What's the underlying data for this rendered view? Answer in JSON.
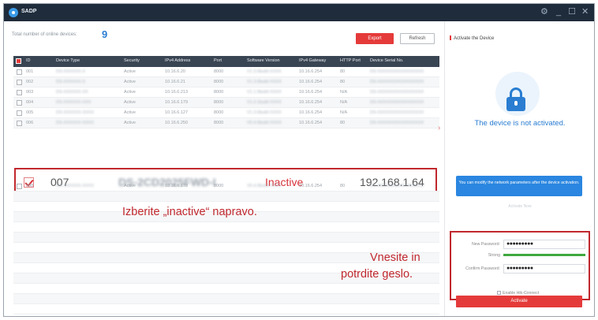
{
  "app": {
    "title": "SADP"
  },
  "header": {
    "total_label": "Total number of online devices:",
    "total_count": "9",
    "export_label": "Export",
    "refresh_label": "Refresh"
  },
  "table": {
    "columns": [
      "ID",
      "Device Type",
      "Security",
      "IPv4 Address",
      "Port",
      "Software Version",
      "IPv4 Gateway",
      "HTTP Port",
      "Device Serial No."
    ],
    "rows": [
      {
        "id": "001",
        "type": "DS-XXXXXX-X",
        "security": "Active",
        "ip": "10.16.6.20",
        "port": "8000",
        "software": "V1.3.0build XXXX",
        "gateway": "10.16.6.254",
        "http": "80",
        "serial": "DS-XXXXXXXXXXXXXXXX"
      },
      {
        "id": "002",
        "type": "DS-XXXXXX-X",
        "security": "Active",
        "ip": "10.16.6.21",
        "port": "8000",
        "software": "V1.3.0build XXXX",
        "gateway": "10.16.6.254",
        "http": "80",
        "serial": "DS-XXXXXXXXXXXXXXXX"
      },
      {
        "id": "003",
        "type": "DS-XXXXXX-XX",
        "security": "Active",
        "ip": "10.16.6.213",
        "port": "8000",
        "software": "V1.1.0build XXXX",
        "gateway": "10.16.6.254",
        "http": "N/A",
        "serial": "DS-XXXXXXXXXXXXXXXX"
      },
      {
        "id": "004",
        "type": "DS-XXXXXX-XXX",
        "security": "Active",
        "ip": "10.16.6.179",
        "port": "8000",
        "software": "V1.0.1build XXXX",
        "gateway": "10.16.6.254",
        "http": "N/A",
        "serial": "DS-XXXXXXXXXXXXXXXX"
      },
      {
        "id": "005",
        "type": "DS-XXXXXX-XXXX",
        "security": "Active",
        "ip": "10.16.6.127",
        "port": "8000",
        "software": "V1.3.0build XXXX",
        "gateway": "10.16.6.254",
        "http": "N/A",
        "serial": "DS-XXXXXXXXXXXXXXXX"
      },
      {
        "id": "006",
        "type": "DS-XXXXXX-XXXX",
        "security": "Active",
        "ip": "10.16.6.250",
        "port": "8000",
        "software": "V5.4.0build XXXX",
        "gateway": "10.16.6.254",
        "http": "80",
        "serial": "DS-XXXXXXXXXXXXXXXX"
      }
    ],
    "selected": {
      "id": "007",
      "type": "DS-2CD2025FWD-I",
      "status": "Inactive",
      "ip": "192.168.1.64"
    },
    "after": [
      {
        "id": "008",
        "type": "DS-XXXXXX-XXXX",
        "security": "Active",
        "ip": "10.16.6.178",
        "port": "8000",
        "software": "V5.4.0build XXXX",
        "gateway": "10.16.6.254",
        "http": "80",
        "serial": "DS-XXXXXXXXXXXXXXXX"
      }
    ]
  },
  "annotations": {
    "left": "Izberite „inactive“ napravo.",
    "right_line1": "Vnesite in",
    "right_line2": "potrdite geslo."
  },
  "panel": {
    "title": "Activate the Device",
    "status_text": "The device is not activated.",
    "tooltip": "You can modify the network parameters after the device activation.",
    "edit_link": "Activate Now",
    "new_password_label": "New Password:",
    "new_password_value": "●●●●●●●●●",
    "strength_label": "Strong",
    "confirm_label": "Confirm Password:",
    "confirm_value": "●●●●●●●●●",
    "enable_label": "Enable Hik-Connect",
    "activate_label": "Activate"
  },
  "icons": {
    "app": "app-logo-icon",
    "settings": "gear-icon",
    "minimize": "minimize-icon",
    "maximize": "maximize-icon",
    "close": "close-icon",
    "lock": "lock-icon"
  },
  "colors": {
    "accent_red": "#e53a3a",
    "accent_blue": "#2a7dd1",
    "annotation_red": "#c0282e"
  }
}
